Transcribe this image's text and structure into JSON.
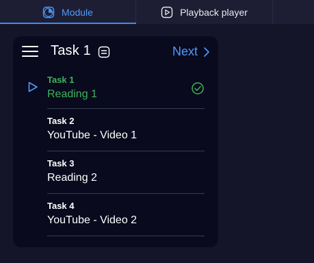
{
  "tabs": [
    {
      "label": "Module",
      "icon": "module-icon",
      "active": true
    },
    {
      "label": "Playback player",
      "icon": "playback-icon",
      "active": false
    }
  ],
  "card": {
    "title": "Task 1",
    "next_label": "Next"
  },
  "tasks": [
    {
      "label": "Task 1",
      "name": "Reading 1",
      "status": "completed",
      "current": true
    },
    {
      "label": "Task 2",
      "name": "YouTube - Video 1",
      "status": "pending",
      "current": false
    },
    {
      "label": "Task 3",
      "name": "Reading 2",
      "status": "pending",
      "current": false
    },
    {
      "label": "Task 4",
      "name": "YouTube - Video 2",
      "status": "pending",
      "current": false
    }
  ],
  "colors": {
    "accent": "#4d9bff",
    "success": "#3cb55a",
    "background": "#141529",
    "card": "#090a1d",
    "tabbar": "#1d1e33"
  }
}
